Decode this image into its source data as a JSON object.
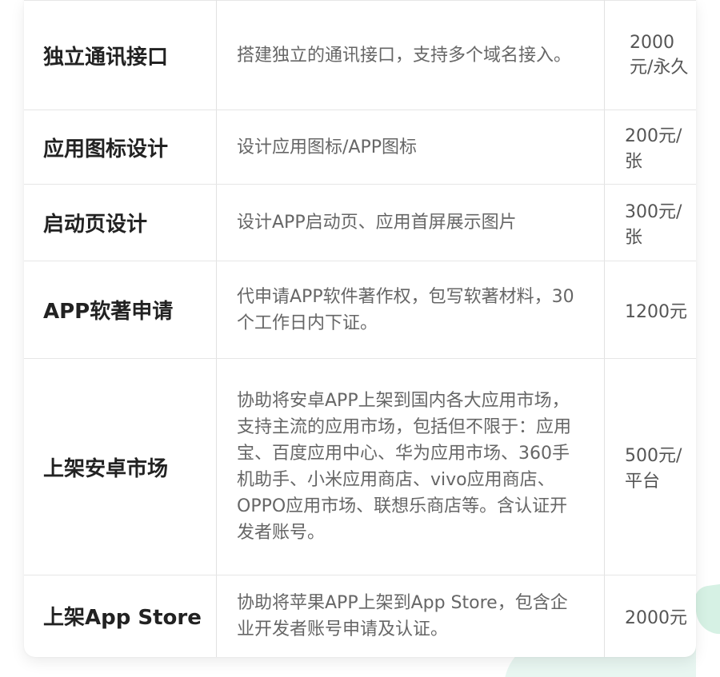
{
  "services": [
    {
      "name": "独立通讯接口",
      "desc": "搭建独立的通讯接口，支持多个域名接入。",
      "price": "2000元/永久"
    },
    {
      "name": "应用图标设计",
      "desc": "设计应用图标/APP图标",
      "price": "200元/张"
    },
    {
      "name": "启动页设计",
      "desc": "设计APP启动页、应用首屏展示图片",
      "price": "300元/张"
    },
    {
      "name": "APP软著申请",
      "desc": "代申请APP软件著作权，包写软著材料，30个工作日内下证。",
      "price": "1200元"
    },
    {
      "name": "上架安卓市场",
      "desc": "协助将安卓APP上架到国内各大应用市场，支持主流的应用市场，包括但不限于：应用宝、百度应用中心、华为应用市场、360手机助手、小米应用商店、vivo应用商店、OPPO应用市场、联想乐商店等。含认证开发者账号。",
      "price": "500元/平台"
    },
    {
      "name": "上架App Store",
      "desc": "协助将苹果APP上架到App Store，包含企业开发者账号申请及认证。",
      "price": "2000元"
    }
  ]
}
